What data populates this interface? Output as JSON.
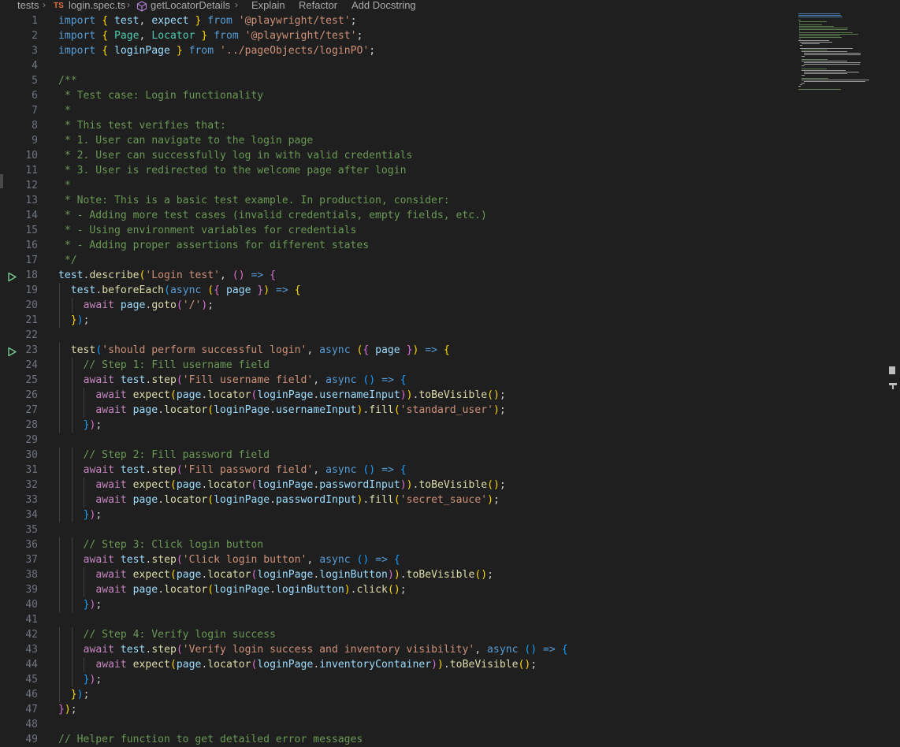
{
  "breadcrumb": {
    "folder": "tests",
    "file_badge": "TS",
    "file": "login.spec.ts",
    "symbol": "getLocatorDetails",
    "actions": [
      "Explain",
      "Refactor",
      "Add Docstring"
    ]
  },
  "colors": {
    "background": "#1f1f1f",
    "keyword": "#569cd6",
    "control": "#c586c0",
    "string": "#ce9178",
    "comment": "#6a9955",
    "function": "#dcdcaa",
    "variable": "#9cdcfe",
    "run_icon": "#73c991"
  },
  "icons": [
    "chevron-right-icon",
    "typescript-file-icon",
    "symbol-method-icon",
    "run-test-icon"
  ],
  "editor": {
    "line_numbers": [
      "1",
      "2",
      "3",
      "4",
      "5",
      "6",
      "7",
      "8",
      "9",
      "10",
      "11",
      "12",
      "13",
      "14",
      "15",
      "16",
      "17",
      "18",
      "19",
      "20",
      "21",
      "22",
      "23",
      "24",
      "25",
      "26",
      "27",
      "28",
      "29",
      "30",
      "31",
      "32",
      "33",
      "34",
      "35",
      "36",
      "37",
      "38",
      "39",
      "40",
      "41",
      "42",
      "43",
      "44",
      "45",
      "46",
      "47",
      "48",
      "49"
    ],
    "run_gutter_lines": [
      "18",
      "23"
    ],
    "lines": [
      "import { test, expect } from '@playwright/test';",
      "import { Page, Locator } from '@playwright/test';",
      "import { loginPage } from '../pageObjects/loginPO';",
      "",
      "/**",
      " * Test case: Login functionality",
      " *",
      " * This test verifies that:",
      " * 1. User can navigate to the login page",
      " * 2. User can successfully log in with valid credentials",
      " * 3. User is redirected to the welcome page after login",
      " *",
      " * Note: This is a basic test example. In production, consider:",
      " * - Adding more test cases (invalid credentials, empty fields, etc.)",
      " * - Using environment variables for credentials",
      " * - Adding proper assertions for different states",
      " */",
      "test.describe('Login test', () => {",
      "  test.beforeEach(async ({ page }) => {",
      "    await page.goto('/');",
      "  });",
      "",
      "  test('should perform successful login', async ({ page }) => {",
      "    // Step 1: Fill username field",
      "    await test.step('Fill username field', async () => {",
      "      await expect(page.locator(loginPage.usernameInput)).toBeVisible();",
      "      await page.locator(loginPage.usernameInput).fill('standard_user');",
      "    });",
      "",
      "    // Step 2: Fill password field",
      "    await test.step('Fill password field', async () => {",
      "      await expect(page.locator(loginPage.passwordInput)).toBeVisible();",
      "      await page.locator(loginPage.passwordInput).fill('secret_sauce');",
      "    });",
      "",
      "    // Step 3: Click login button",
      "    await test.step('Click login button', async () => {",
      "      await expect(page.locator(loginPage.loginButton)).toBeVisible();",
      "      await page.locator(loginPage.loginButton).click();",
      "    });",
      "",
      "    // Step 4: Verify login success",
      "    await test.step('Verify login success and inventory visibility', async () => {",
      "      await expect(page.locator(loginPage.inventoryContainer)).toBeVisible();",
      "    });",
      "  });",
      "});",
      "",
      "// Helper function to get detailed error messages"
    ]
  }
}
